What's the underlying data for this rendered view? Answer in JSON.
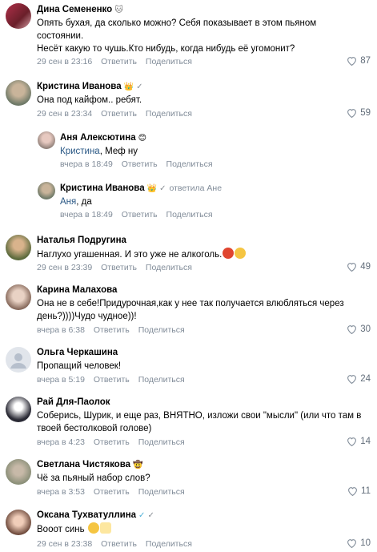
{
  "actions": {
    "reply": "Ответить",
    "share": "Поделиться"
  },
  "comments": [
    {
      "name": "Дина Семененко",
      "text": "Опять бухая, да сколько можно? Себя показывает в этом пьяном состоянии.",
      "text2": "Несёт какую то чушь.Кто нибудь, когда нибудь её угомонит?",
      "date": "29 сен в 23:16",
      "likes": "87"
    },
    {
      "name": "Кристина Иванова",
      "badge": "👑",
      "text": "Она под кайфом.. ребят.",
      "date": "29 сен в 23:34",
      "likes": "59"
    },
    {
      "name": "Аня Алексютина",
      "badge": "😊",
      "mention": "Кристина",
      "text": ", Меф ну",
      "date": "вчера в 18:49"
    },
    {
      "name": "Кристина Иванова",
      "badge": "👑",
      "reply_to": "ответила Ане",
      "mention": "Аня",
      "text": ", да",
      "date": "вчера в 18:49"
    },
    {
      "name": "Наталья Подругина",
      "text": "Наглухо угашенная. И это уже не алкоголь.",
      "date": "29 сен в 23:39",
      "likes": "49"
    },
    {
      "name": "Карина Малахова",
      "text": "Она не в себе!Придурочная,как у нее так получается влюбляться через",
      "text2": "день?))))Чудо чудное))!",
      "date": "вчера в 6:38",
      "likes": "30"
    },
    {
      "name": "Ольга Черкашина",
      "text": "Пропащий человек!",
      "date": "вчера в 5:19",
      "likes": "24"
    },
    {
      "name": "Рай Для-Паолок",
      "text": "Соберись, Шурик, и еще раз, ВНЯТНО, изложи свои \"мысли\" (или что там в",
      "text2": "твоей бестолковой голове)",
      "date": "вчера в 4:23",
      "likes": "14"
    },
    {
      "name": "Светлана Чистякова",
      "badge": "🤠",
      "text": "Чё за пьяный набор слов?",
      "date": "вчера в 3:53",
      "likes": "11"
    },
    {
      "name": "Оксана Тухватуллина",
      "text": "Вооот синь",
      "date": "29 сен в 23:38",
      "likes": "10"
    }
  ]
}
